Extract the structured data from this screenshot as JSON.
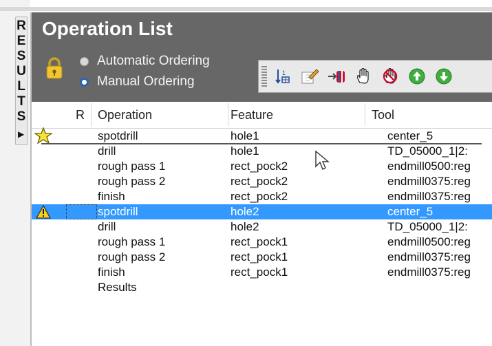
{
  "side_tab": {
    "label": "RESULTS",
    "letters": [
      "R",
      "E",
      "S",
      "U",
      "L",
      "T",
      "S"
    ],
    "arrow": "▶"
  },
  "panel": {
    "title": "Operation List",
    "ordering": {
      "automatic_label": "Automatic Ordering",
      "manual_label": "Manual Ordering",
      "selected": "manual"
    },
    "toolbar": {
      "buttons": [
        "sort-icon",
        "edit-icon",
        "move-tool-icon",
        "hand-icon",
        "hand-stop-icon",
        "move-up-icon",
        "move-down-icon"
      ]
    }
  },
  "table": {
    "columns": {
      "r": "R",
      "operation": "Operation",
      "feature": "Feature",
      "tool": "Tool"
    },
    "rows": [
      {
        "operation": "spotdrill",
        "feature": "hole1",
        "tool": "center_5"
      },
      {
        "operation": "drill",
        "feature": "hole1",
        "tool": "TD_05000_1|2:"
      },
      {
        "operation": "rough pass 1",
        "feature": "rect_pock2",
        "tool": "endmill0500:reg"
      },
      {
        "operation": "rough pass 2",
        "feature": "rect_pock2",
        "tool": "endmill0375:reg"
      },
      {
        "operation": "finish",
        "feature": "rect_pock2",
        "tool": "endmill0375:reg"
      },
      {
        "operation": "spotdrill",
        "feature": "hole2",
        "tool": "center_5"
      },
      {
        "operation": "drill",
        "feature": "hole2",
        "tool": "TD_05000_1|2:"
      },
      {
        "operation": "rough pass 1",
        "feature": "rect_pock1",
        "tool": "endmill0500:reg"
      },
      {
        "operation": "rough pass 2",
        "feature": "rect_pock1",
        "tool": "endmill0375:reg"
      },
      {
        "operation": "finish",
        "feature": "rect_pock1",
        "tool": "endmill0375:reg"
      },
      {
        "operation": "Results",
        "feature": "",
        "tool": ""
      }
    ]
  },
  "colors": {
    "header_bg": "#676767",
    "selection": "#3399ff",
    "radio_accent": "#2a63b0"
  }
}
